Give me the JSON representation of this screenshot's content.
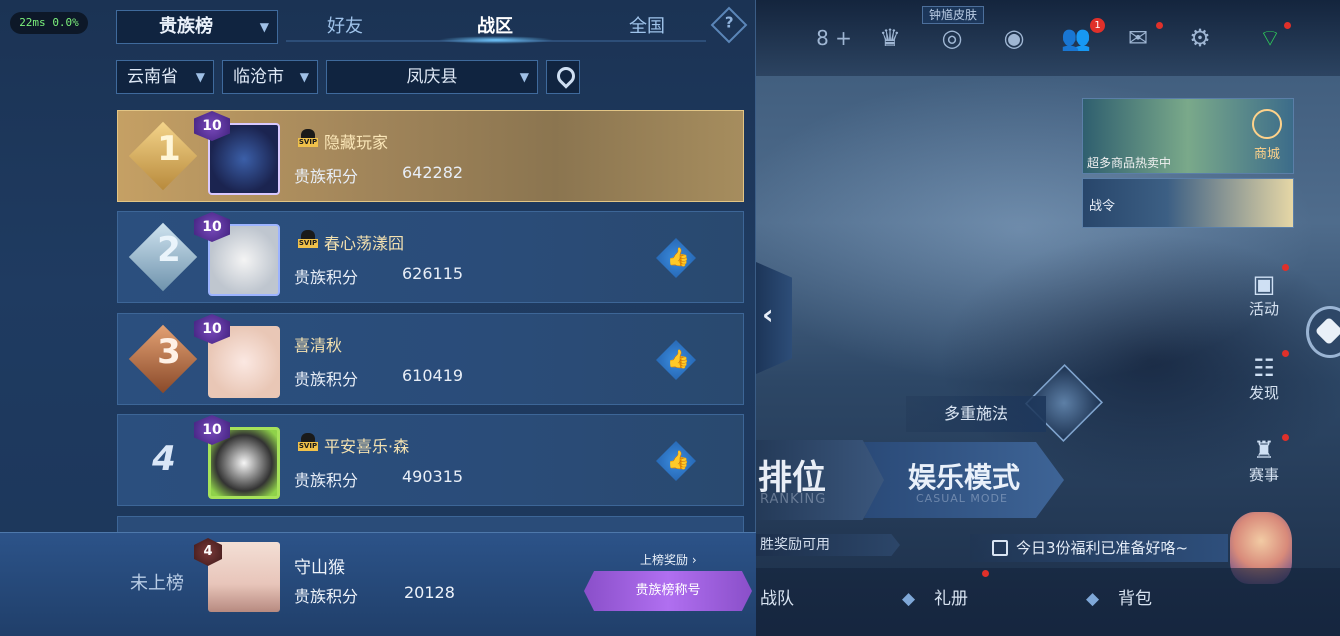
{
  "status": {
    "ping": "22ms",
    "loss": "0.0%"
  },
  "header": {
    "category": "贵族榜",
    "tabs": [
      {
        "label": "好友",
        "active": false
      },
      {
        "label": "战区",
        "active": true
      },
      {
        "label": "全国",
        "active": false
      }
    ],
    "help": "?"
  },
  "filters": {
    "province": "云南省",
    "city": "临沧市",
    "county": "凤庆县"
  },
  "leaderboard": {
    "score_label": "贵族积分",
    "rows": [
      {
        "rank": "1",
        "level": "10",
        "name": "隐藏玩家",
        "vip": true,
        "score": "642282",
        "likeable": false
      },
      {
        "rank": "2",
        "level": "10",
        "name": "春心荡漾囧",
        "vip": true,
        "score": "626115",
        "likeable": true
      },
      {
        "rank": "3",
        "level": "10",
        "name": "喜清秋",
        "vip": false,
        "score": "610419",
        "likeable": true
      },
      {
        "rank": "4",
        "level": "10",
        "name": "平安喜乐·森",
        "vip": true,
        "score": "490315",
        "likeable": true
      }
    ]
  },
  "self": {
    "rank_text": "未上榜",
    "level": "4",
    "name": "守山猴",
    "score": "20128",
    "reward_link": "上榜奖励",
    "title_button": "贵族榜称号"
  },
  "game": {
    "skin_tag": "钟馗皮肤",
    "top_count": "8",
    "mail_badge": "1",
    "shop_promo": "超多商品热卖中",
    "shop": "商城",
    "battle_pass": "战令",
    "side_menu": [
      "活动",
      "发现",
      "赛事"
    ],
    "multi_cast": "多重施法",
    "ranking_big": "排位",
    "ranking_small": "RANKING",
    "casual_big": "娱乐模式",
    "casual_small": "CASUAL MODE",
    "reward_strip": "胜奖励可用",
    "welfare": "今日3份福利已准备好咯~",
    "bottom_nav": [
      "战队",
      "礼册",
      "背包"
    ]
  }
}
